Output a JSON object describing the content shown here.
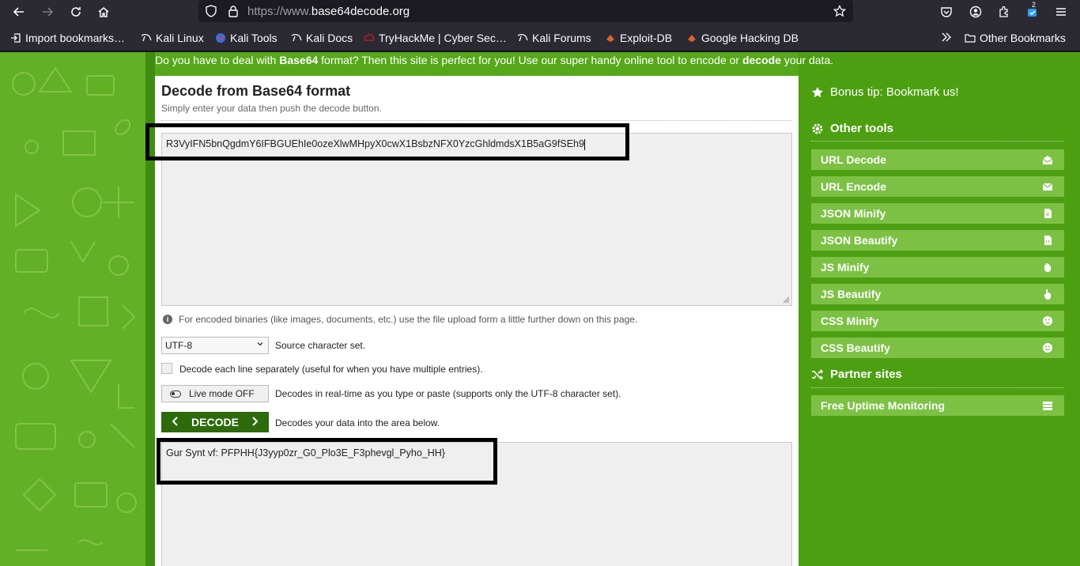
{
  "browser": {
    "url_prefix": "https://www.",
    "url_host": "base64decode.org",
    "extensions_badge": "2"
  },
  "bookmarks": [
    {
      "label": "Import bookmarks…",
      "icon": "import-icon"
    },
    {
      "label": "Kali Linux",
      "icon": "kali-dragon-icon"
    },
    {
      "label": "Kali Tools",
      "icon": "kali-tools-icon"
    },
    {
      "label": "Kali Docs",
      "icon": "kali-dragon-icon"
    },
    {
      "label": "TryHackMe | Cyber Sec…",
      "icon": "tryhackme-icon"
    },
    {
      "label": "Kali Forums",
      "icon": "kali-dragon-icon"
    },
    {
      "label": "Exploit-DB",
      "icon": "exploit-db-icon"
    },
    {
      "label": "Google Hacking DB",
      "icon": "exploit-db-icon"
    }
  ],
  "other_bookmarks": "Other Bookmarks",
  "intro": {
    "part1": "Do you have to deal with ",
    "bold1": "Base64",
    "part2": " format? Then this site is perfect for you! Use our super handy online tool to encode or ",
    "bold2": "decode",
    "part3": " your data."
  },
  "main": {
    "title": "Decode from Base64 format",
    "subtitle": "Simply enter your data then push the decode button.",
    "input_value": "R3VyIFN5bnQgdmY6IFBGUEhIe0ozeXlwMHpyX0cwX1BsbzNFX0YzcGhldmdsX1B5aG9fSEh9",
    "binaries_note": "For encoded binaries (like images, documents, etc.) use the file upload form a little further down on this page.",
    "charset_value": "UTF-8",
    "charset_label": "Source character set.",
    "line_label": "Decode each line separately (useful for when you have multiple entries).",
    "live_mode": "Live mode OFF",
    "live_label": "Decodes in real-time as you type or paste (supports only the UTF-8 character set).",
    "decode_button": "DECODE",
    "decode_label": "Decodes your data into the area below.",
    "output_value": "Gur Synt vf: PFPHH{J3yyp0zr_G0_Plo3E_F3phevgl_Pyho_HH}"
  },
  "sidebar": {
    "bonus_tip": "Bonus tip: Bookmark us!",
    "other_tools_heading": "Other tools",
    "tools": [
      {
        "label": "URL Decode",
        "icon": "envelope-open-icon"
      },
      {
        "label": "URL Encode",
        "icon": "envelope-icon"
      },
      {
        "label": "JSON Minify",
        "icon": "file-icon"
      },
      {
        "label": "JSON Beautify",
        "icon": "file-code-icon"
      },
      {
        "label": "JS Minify",
        "icon": "hand-icon"
      },
      {
        "label": "JS Beautify",
        "icon": "hand-pointer-icon"
      },
      {
        "label": "CSS Minify",
        "icon": "meh-face-icon"
      },
      {
        "label": "CSS Beautify",
        "icon": "smile-face-icon"
      }
    ],
    "partner_heading": "Partner sites",
    "partners": [
      {
        "label": "Free Uptime Monitoring",
        "icon": "server-icon"
      }
    ]
  },
  "colors": {
    "page_green": "#56a81a",
    "button_green": "#7cc144",
    "decode_button": "#2c6a0c",
    "highlight_border": "#000000"
  }
}
